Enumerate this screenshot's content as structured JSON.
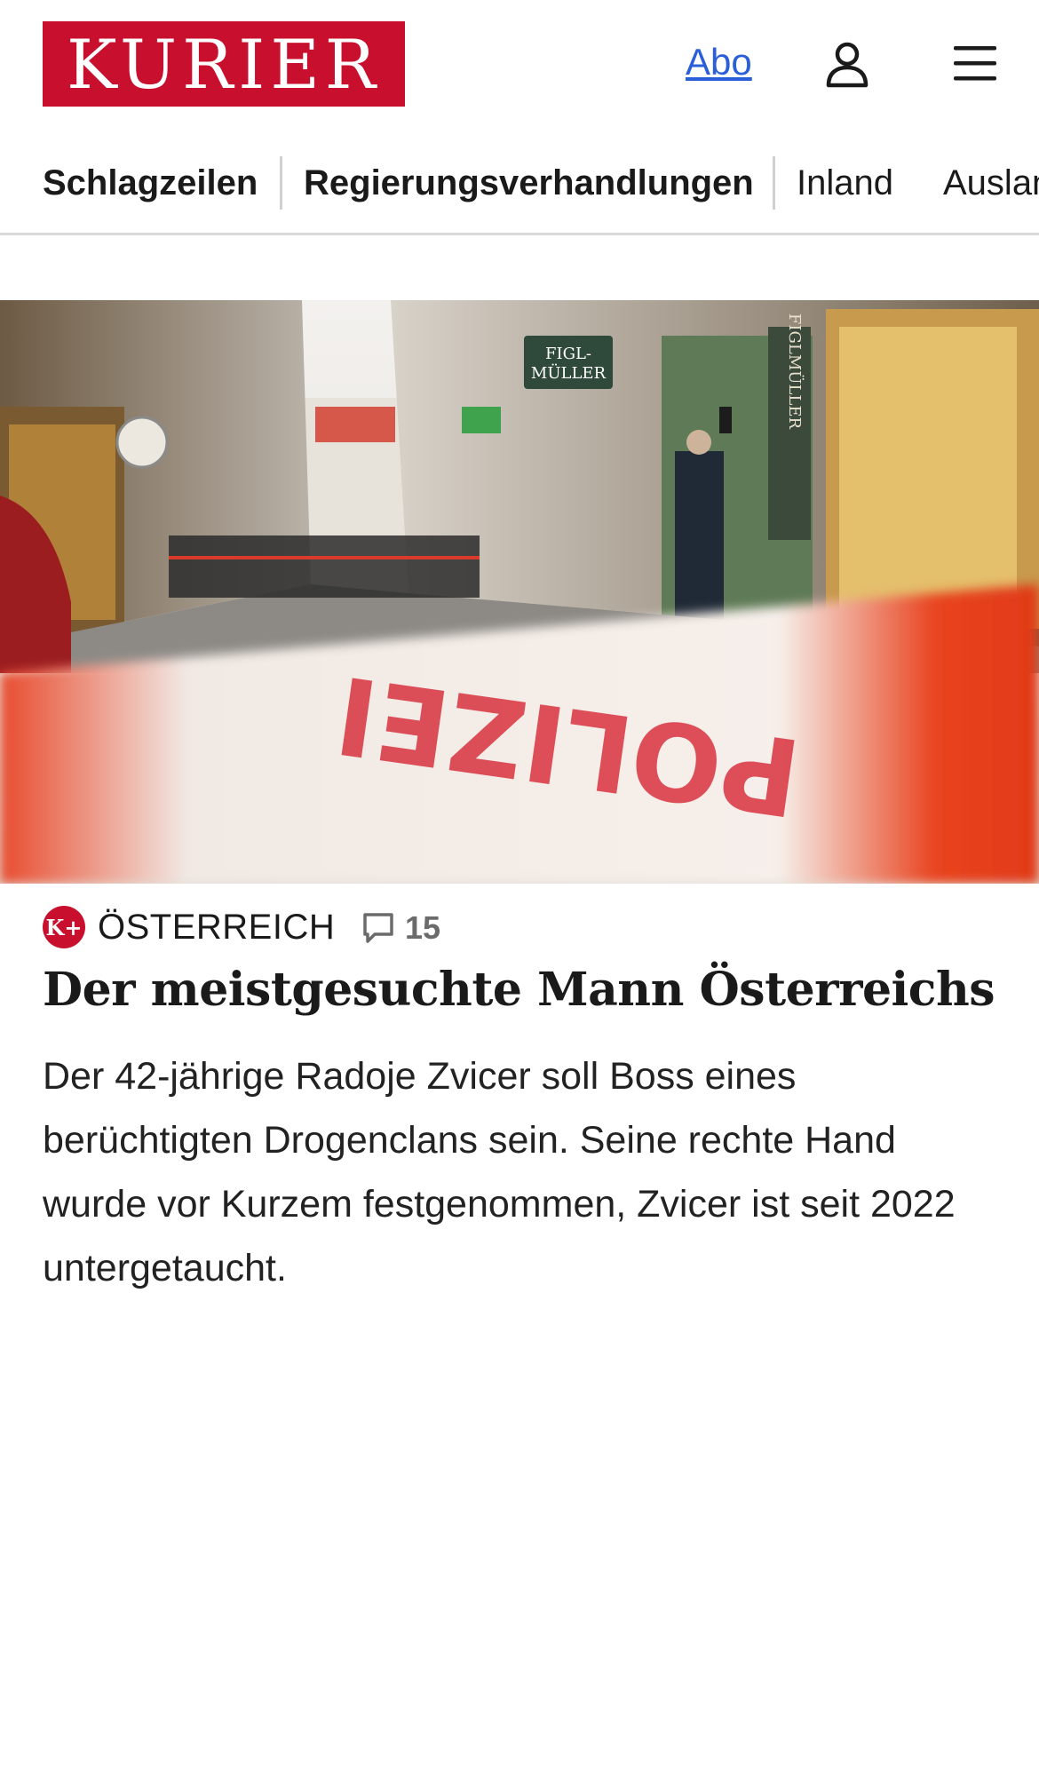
{
  "header": {
    "logo_text": "KURIER",
    "abo_label": "Abo",
    "user_icon": "user-icon",
    "menu_icon": "hamburger-menu-icon"
  },
  "nav": {
    "items": [
      {
        "label": "Schlagzeilen",
        "active": true
      },
      {
        "label": "Regierungsverhandlungen",
        "active": true
      },
      {
        "label": "Inland",
        "active": false
      },
      {
        "label": "Ausland",
        "active": false
      }
    ]
  },
  "article": {
    "badge": "K+",
    "category": "ÖSTERREICH",
    "comment_icon": "comment-icon",
    "comment_count": "15",
    "headline": "Der meistgesuchte Mann Österreichs",
    "teaser": "Der 42-jährige Radoje Zvicer soll Boss eines berüchtigten Drogenclans sein. Seine rechte Hand wurde vor Kurzem festgenommen, Zvicer ist seit 2022 untergetaucht.",
    "image": {
      "sign_figl": "FIGL-MÜLLER",
      "sign_vertical": "FIGLMÜLLER",
      "tape_text": "POLIZEI"
    }
  },
  "colors": {
    "brand_red": "#c8102e",
    "link_blue": "#2b5fd9",
    "nav_divider": "#d9d9d9"
  }
}
